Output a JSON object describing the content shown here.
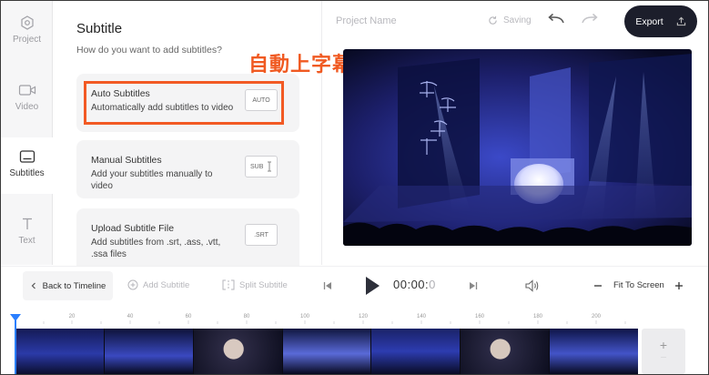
{
  "rail": {
    "items": [
      {
        "label": "Project",
        "icon": "hexagon-icon"
      },
      {
        "label": "Video",
        "icon": "video-camera-icon"
      },
      {
        "label": "Subtitles",
        "icon": "subtitles-icon"
      },
      {
        "label": "Text",
        "icon": "text-t-icon"
      }
    ],
    "active": "Subtitles"
  },
  "panel": {
    "title": "Subtitle",
    "subtitle": "How do you want to add subtitles?",
    "options": [
      {
        "title": "Auto Subtitles",
        "desc": "Automatically add subtitles to video",
        "tag": "AUTO"
      },
      {
        "title": "Manual Subtitles",
        "desc": "Add your subtitles manually to video",
        "tag": "SUB"
      },
      {
        "title": "Upload Subtitle File",
        "desc": "Add subtitles from .srt, .ass, .vtt, .ssa files",
        "tag": ".SRT"
      }
    ]
  },
  "annotation": "自動上字幕",
  "header": {
    "project_name": "Project Name",
    "saving": "Saving",
    "export": "Export"
  },
  "toolbar": {
    "back": "Back to Timeline",
    "add_subtitle": "Add Subtitle",
    "split_subtitle": "Split Subtitle",
    "time_main": "00:00:",
    "time_ms": "0",
    "fit": "Fit To Screen"
  },
  "timeline": {
    "ticks": [
      "20",
      "40",
      "60",
      "80",
      "100",
      "120",
      "140",
      "160",
      "180",
      "200"
    ],
    "add": "+"
  },
  "colors": {
    "accent": "#f25a24",
    "dark": "#1c1e2b",
    "playhead": "#2a7fff"
  }
}
